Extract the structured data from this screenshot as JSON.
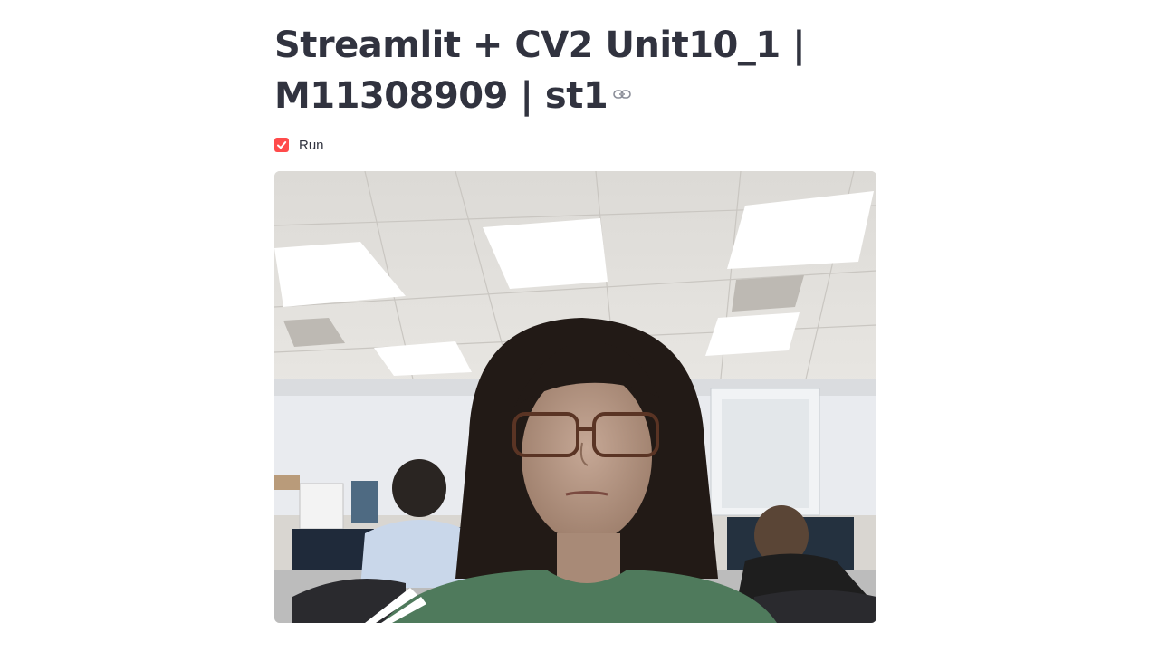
{
  "page": {
    "title_line1": "Streamlit + CV2 Unit10_1 |",
    "title_line2": "M11308909 | st1",
    "anchor_icon": "link-icon"
  },
  "controls": {
    "run_checkbox": {
      "label": "Run",
      "checked": true,
      "color": "#ff4b4b"
    }
  },
  "video": {
    "description_name": "webcam-frame",
    "accent_colors": {
      "ceiling": "#e6e4e0",
      "light_panel": "#ffffff",
      "wall": "#e9ebef",
      "hair": "#221a16",
      "skin": "#b89a86",
      "sweater": "#4f7a5c"
    }
  }
}
